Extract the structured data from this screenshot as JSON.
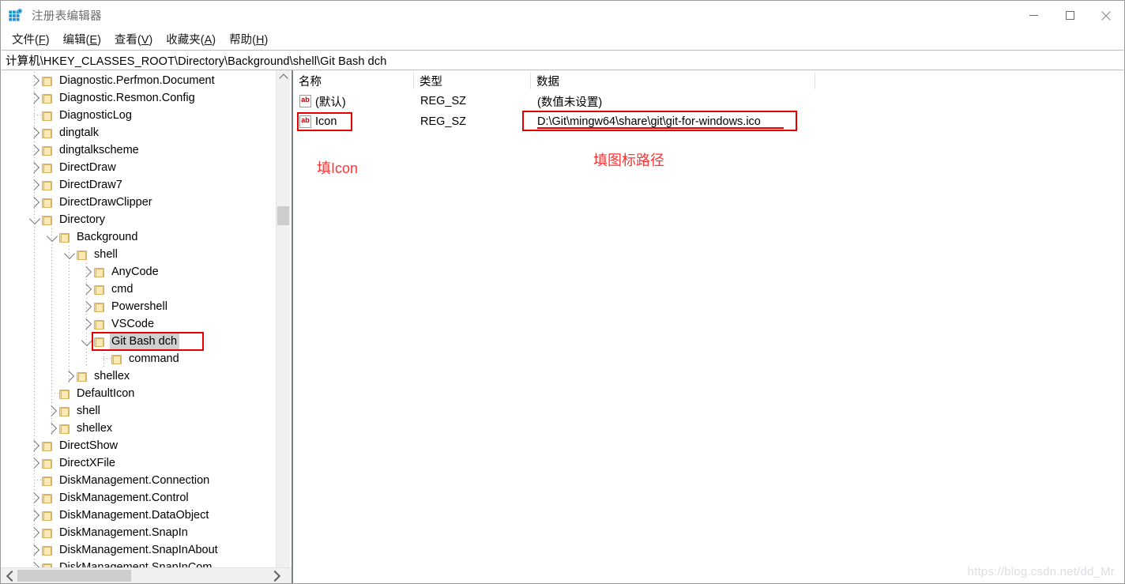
{
  "window": {
    "title": "注册表编辑器",
    "icon": "registry-editor-icon",
    "controls": {
      "minimize": "—",
      "maximize": "□",
      "close": "✕"
    }
  },
  "menubar": {
    "items": [
      {
        "label": "文件(F)",
        "text": "文件(",
        "accel": "F",
        "tail": ")"
      },
      {
        "label": "编辑(E)",
        "text": "编辑(",
        "accel": "E",
        "tail": ")"
      },
      {
        "label": "查看(V)",
        "text": "查看(",
        "accel": "V",
        "tail": ")"
      },
      {
        "label": "收藏夹(A)",
        "text": "收藏夹(",
        "accel": "A",
        "tail": ")"
      },
      {
        "label": "帮助(H)",
        "text": "帮助(",
        "accel": "H",
        "tail": ")"
      }
    ]
  },
  "address": {
    "path": "计算机\\HKEY_CLASSES_ROOT\\Directory\\Background\\shell\\Git Bash dch"
  },
  "tree": {
    "items": [
      {
        "label": "Diagnostic.Perfmon.Document",
        "depth": 1,
        "state": "collapsed",
        "selected": false
      },
      {
        "label": "Diagnostic.Resmon.Config",
        "depth": 1,
        "state": "collapsed",
        "selected": false
      },
      {
        "label": "DiagnosticLog",
        "depth": 1,
        "state": "leaf",
        "selected": false
      },
      {
        "label": "dingtalk",
        "depth": 1,
        "state": "collapsed",
        "selected": false
      },
      {
        "label": "dingtalkscheme",
        "depth": 1,
        "state": "collapsed",
        "selected": false
      },
      {
        "label": "DirectDraw",
        "depth": 1,
        "state": "collapsed",
        "selected": false
      },
      {
        "label": "DirectDraw7",
        "depth": 1,
        "state": "collapsed",
        "selected": false
      },
      {
        "label": "DirectDrawClipper",
        "depth": 1,
        "state": "collapsed",
        "selected": false
      },
      {
        "label": "Directory",
        "depth": 1,
        "state": "expanded",
        "selected": false
      },
      {
        "label": "Background",
        "depth": 2,
        "state": "expanded",
        "selected": false
      },
      {
        "label": "shell",
        "depth": 3,
        "state": "expanded",
        "selected": false
      },
      {
        "label": "AnyCode",
        "depth": 4,
        "state": "collapsed",
        "selected": false
      },
      {
        "label": "cmd",
        "depth": 4,
        "state": "collapsed",
        "selected": false
      },
      {
        "label": "Powershell",
        "depth": 4,
        "state": "collapsed",
        "selected": false
      },
      {
        "label": "VSCode",
        "depth": 4,
        "state": "collapsed",
        "selected": false
      },
      {
        "label": "Git Bash dch",
        "depth": 4,
        "state": "expanded",
        "selected": true
      },
      {
        "label": "command",
        "depth": 5,
        "state": "leaf",
        "selected": false
      },
      {
        "label": "shellex",
        "depth": 3,
        "state": "collapsed",
        "selected": false
      },
      {
        "label": "DefaultIcon",
        "depth": 2,
        "state": "leaf",
        "selected": false
      },
      {
        "label": "shell",
        "depth": 2,
        "state": "collapsed",
        "selected": false
      },
      {
        "label": "shellex",
        "depth": 2,
        "state": "collapsed",
        "selected": false
      },
      {
        "label": "DirectShow",
        "depth": 1,
        "state": "collapsed",
        "selected": false
      },
      {
        "label": "DirectXFile",
        "depth": 1,
        "state": "collapsed",
        "selected": false
      },
      {
        "label": "DiskManagement.Connection",
        "depth": 1,
        "state": "leaf",
        "selected": false
      },
      {
        "label": "DiskManagement.Control",
        "depth": 1,
        "state": "collapsed",
        "selected": false
      },
      {
        "label": "DiskManagement.DataObject",
        "depth": 1,
        "state": "collapsed",
        "selected": false
      },
      {
        "label": "DiskManagement.SnapIn",
        "depth": 1,
        "state": "collapsed",
        "selected": false
      },
      {
        "label": "DiskManagement.SnapInAbout",
        "depth": 1,
        "state": "collapsed",
        "selected": false
      },
      {
        "label": "DiskManagement.SnapInCom",
        "depth": 1,
        "state": "collapsed",
        "selected": false
      }
    ]
  },
  "values": {
    "columns": [
      "名称",
      "类型",
      "数据"
    ],
    "rows": [
      {
        "name": "(默认)",
        "type": "REG_SZ",
        "data": "(数值未设置)",
        "icon": "string-value-icon",
        "boxed": false
      },
      {
        "name": "Icon",
        "type": "REG_SZ",
        "data": "D:\\Git\\mingw64\\share\\git\\git-for-windows.ico",
        "icon": "string-value-icon",
        "boxed": true
      }
    ]
  },
  "annotations": {
    "name_note": "填Icon",
    "data_note": "填图标路径",
    "color": "#ff3333"
  },
  "watermark": {
    "text": "https://blog.csdn.net/dd_Mr"
  }
}
